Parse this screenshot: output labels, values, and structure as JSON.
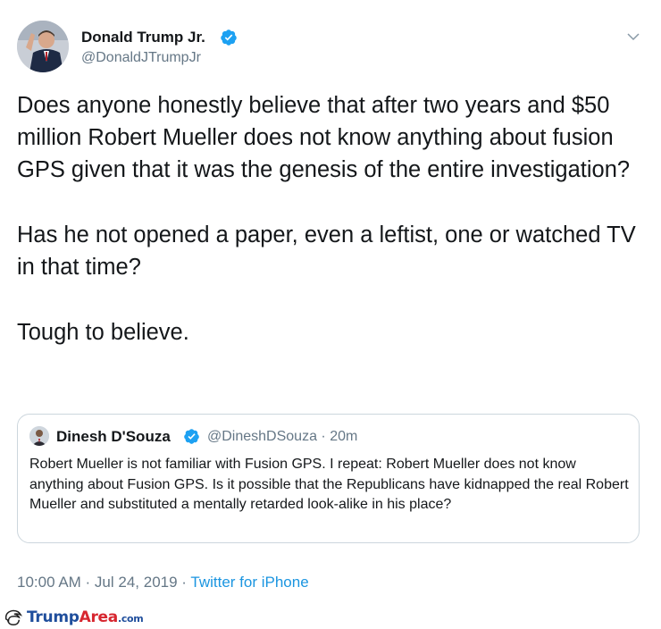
{
  "tweet": {
    "author_name": "Donald Trump Jr.",
    "author_handle": "@DonaldJTrumpJr",
    "paragraphs": [
      "Does anyone honestly believe that after two years and $50 million Robert Mueller does not know anything about fusion GPS given that it was the genesis of the entire investigation?",
      "Has he not opened a paper, even a leftist, one or watched TV in that time?",
      "Tough to believe."
    ],
    "timestamp": "10:00 AM · Jul 24, 2019 · ",
    "source": "Twitter for iPhone"
  },
  "quoted_tweet": {
    "author_name": "Dinesh D'Souza",
    "author_handle": "@DineshDSouza · 20m",
    "text": "Robert Mueller is not familiar with Fusion GPS. I repeat: Robert Mueller does not know anything about Fusion GPS. Is it possible that the Republicans have kidnapped the real Robert Mueller and substituted a mentally retarded look-alike in his place?"
  },
  "watermark": {
    "part1": "Trump",
    "part2": "Area",
    "part3": ".com"
  },
  "colors": {
    "verified": "#1da1f2",
    "link": "#1b95e0",
    "secondary_text": "#657786",
    "border": "#ccd6dd"
  },
  "icons": [
    "verified-badge-icon",
    "chevron-down-icon",
    "trump-hair-logo-icon"
  ]
}
